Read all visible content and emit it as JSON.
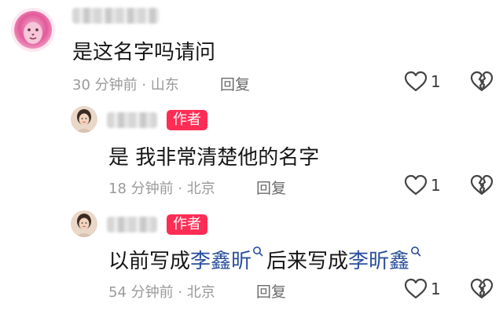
{
  "comments": [
    {
      "text": "是这名字吗请问",
      "time": "30 分钟前 · 山东",
      "reply_label": "回复",
      "likes": "1"
    },
    {
      "badge": "作者",
      "text": "是 我非常清楚他的名字",
      "time": "18 分钟前 · 北京",
      "reply_label": "回复",
      "likes": "1"
    },
    {
      "badge": "作者",
      "text_prefix": "以前写成",
      "link1": "李鑫昕",
      "text_middle": "后来写成",
      "link2": "李昕鑫",
      "time": "54 分钟前 · 北京",
      "reply_label": "回复",
      "likes": "1"
    }
  ],
  "colors": {
    "author_badge": "#ff2d55",
    "link": "#2a4f9c",
    "meta": "#9a9a9a"
  },
  "icons": [
    "heart-outline-icon",
    "broken-heart-icon",
    "search-icon",
    "lion-avatar",
    "user-avatar"
  ]
}
